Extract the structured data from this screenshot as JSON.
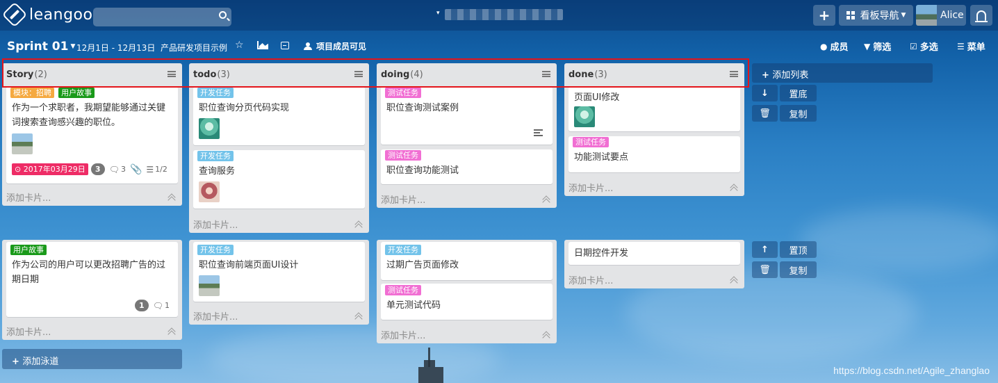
{
  "app": {
    "logo_text": "leangoo",
    "search_placeholder": "",
    "board_selector_caret": "▾",
    "add_label": "+",
    "board_nav_label": "看板导航",
    "user_name": "Alice"
  },
  "sprint": {
    "title": "Sprint 01",
    "dates": "12月1日 - 12月13日",
    "project": "产品研发项目示例",
    "visibility": "项目成员可见",
    "menu": {
      "members": "成员",
      "filter": "筛选",
      "multiselect": "多选",
      "menu": "菜单"
    }
  },
  "lanes": [
    {
      "lists": [
        {
          "name": "Story",
          "count": "(2)",
          "add_card": "添加卡片...",
          "cards": [
            {
              "tags": [
                {
                  "text": "模块：招聘",
                  "color": "#f5a940"
                },
                {
                  "text": "用户故事",
                  "color": "#1a9a1a"
                }
              ],
              "title": "作为一个求职者，我期望能够通过关键词搜索查询感兴趣的职位。",
              "due": "2017年03月29日",
              "badge_count": "3",
              "comments": "3",
              "checklist": "1/2"
            }
          ]
        },
        {
          "name": "todo",
          "count": "(3)",
          "add_card": "添加卡片...",
          "cards": [
            {
              "tags": [
                {
                  "text": "开发任务",
                  "color": "#73c3ea"
                }
              ],
              "title": "职位查询分页代码实现"
            },
            {
              "tags": [
                {
                  "text": "开发任务",
                  "color": "#73c3ea"
                }
              ],
              "title": "查询服务"
            }
          ]
        },
        {
          "name": "doing",
          "count": "(4)",
          "add_card": "添加卡片...",
          "cards": [
            {
              "tags": [
                {
                  "text": "测试任务",
                  "color": "#f16fd3"
                }
              ],
              "title": "职位查询测试案例"
            },
            {
              "tags": [
                {
                  "text": "测试任务",
                  "color": "#f16fd3"
                }
              ],
              "title": "职位查询功能测试"
            }
          ]
        },
        {
          "name": "done",
          "count": "(3)",
          "add_card": "添加卡片...",
          "cards": [
            {
              "title": "页面UI修改"
            },
            {
              "tags": [
                {
                  "text": "测试任务",
                  "color": "#f16fd3"
                }
              ],
              "title": "功能测试要点"
            }
          ]
        }
      ],
      "side": {
        "add_list": "添加列表",
        "move": "置底",
        "copy": "复制"
      }
    },
    {
      "lists": [
        {
          "add_card": "添加卡片...",
          "cards": [
            {
              "tags": [
                {
                  "text": "用户故事",
                  "color": "#1a9a1a"
                }
              ],
              "title": "作为公司的用户可以更改招聘广告的过期日期",
              "badge_count": "1",
              "comments": "1"
            }
          ]
        },
        {
          "add_card": "添加卡片...",
          "cards": [
            {
              "tags": [
                {
                  "text": "开发任务",
                  "color": "#73c3ea"
                }
              ],
              "title": "职位查询前端页面UI设计"
            }
          ]
        },
        {
          "add_card": "添加卡片...",
          "cards": [
            {
              "tags": [
                {
                  "text": "开发任务",
                  "color": "#73c3ea"
                }
              ],
              "title": "过期广告页面修改"
            },
            {
              "tags": [
                {
                  "text": "测试任务",
                  "color": "#f16fd3"
                }
              ],
              "title": "单元测试代码"
            }
          ]
        },
        {
          "add_card": "添加卡片...",
          "cards": [
            {
              "title": "日期控件开发"
            }
          ]
        }
      ],
      "side": {
        "move": "置顶",
        "copy": "复制"
      }
    }
  ],
  "add_swimlane": "添加泳道",
  "watermark": "https://blog.csdn.net/Agile_zhanglao",
  "colors": {
    "highlight": "#e3141a",
    "dev_tag": "#73c3ea",
    "test_tag": "#f16fd3",
    "module_tag": "#f5a940",
    "story_tag": "#1a9a1a",
    "due_badge": "#ee2c66"
  },
  "icons": [
    "leangoo-logo-icon",
    "search-icon",
    "plus-icon",
    "grid-icon",
    "bell-icon",
    "star-icon",
    "chart-icon",
    "collapse-icon",
    "people-icon",
    "user-icon",
    "filter-icon",
    "checkbox-icon",
    "menu-icon",
    "hamburger-icon",
    "clock-icon",
    "comment-icon",
    "paperclip-icon",
    "checklist-icon",
    "description-icon",
    "arrow-down-icon",
    "arrow-up-icon",
    "trash-icon",
    "chevron-up-icon"
  ]
}
